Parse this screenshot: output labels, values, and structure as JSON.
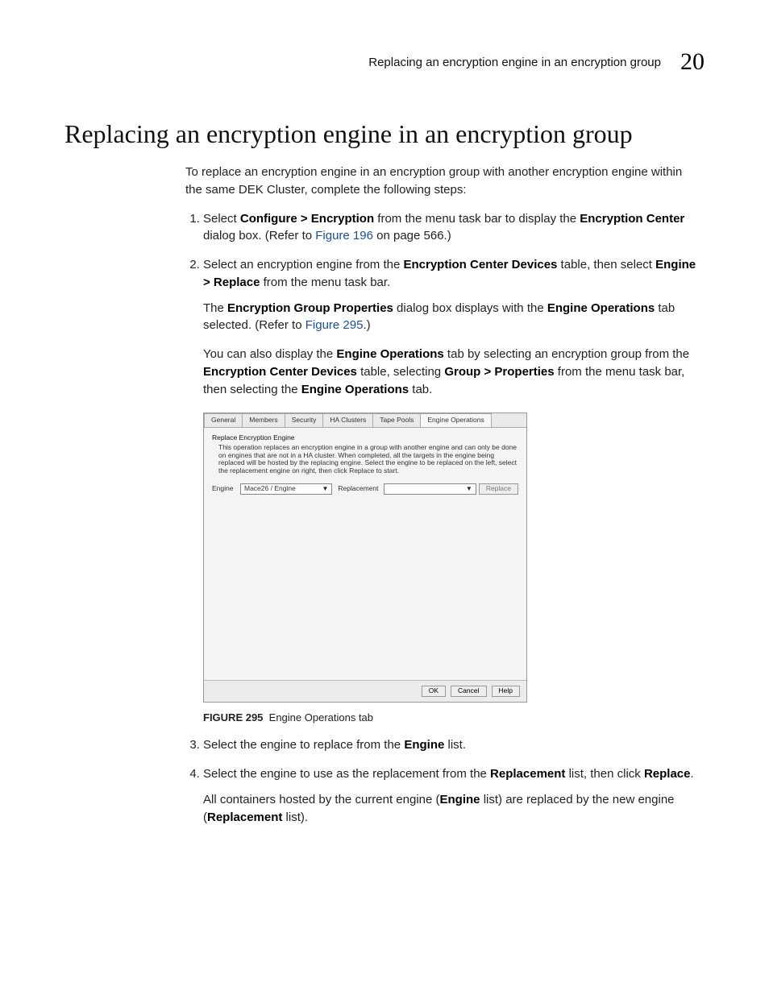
{
  "runningHeader": {
    "title": "Replacing an encryption engine in an encryption group",
    "chapterNumber": "20"
  },
  "heading": "Replacing an encryption engine in an encryption group",
  "intro": "To replace an encryption engine in an encryption group with another encryption engine within the same DEK Cluster, complete the following steps:",
  "step1": {
    "a": "Select ",
    "b": "Configure > Encryption",
    "c": " from the menu task bar to display the ",
    "d": "Encryption Center",
    "e": " dialog box. (Refer to ",
    "link": "Figure 196",
    "f": " on page 566.)"
  },
  "step2": {
    "a": "Select an encryption engine from the ",
    "b": "Encryption Center Devices",
    "c": " table, then select ",
    "d": "Engine > Replace",
    "e": " from the menu task bar.",
    "p2": {
      "a": "The ",
      "b": "Encryption Group Properties",
      "c": " dialog box displays with the ",
      "d": "Engine Operations",
      "e": " tab selected. (Refer to ",
      "link": "Figure 295",
      "f": ".)"
    },
    "p3": {
      "a": "You can also display the ",
      "b": "Engine Operations",
      "c": " tab by selecting an encryption group from the ",
      "d": "Encryption Center Devices",
      "e": " table, selecting ",
      "f": "Group > Properties",
      "g": " from the menu task bar, then selecting the ",
      "h": "Engine Operations",
      "i": " tab."
    }
  },
  "dialog": {
    "tabs": [
      "General",
      "Members",
      "Security",
      "HA Clusters",
      "Tape Pools",
      "Engine Operations"
    ],
    "activeTab": "Engine Operations",
    "sectionTitle": "Replace Encryption Engine",
    "description": "This operation replaces an encryption engine in a group with another engine and can only be done on engines that are not in a HA cluster. When completed, all the targets in the engine being replaced will be hosted by the replacing engine. Select the engine to be replaced on the left, select the replacement engine on right, then click Replace to start.",
    "engineLabel": "Engine",
    "engineValue": "Mace26 / Engine",
    "replacementLabel": "Replacement",
    "replacementValue": "",
    "replaceBtn": "Replace",
    "footer": {
      "ok": "OK",
      "cancel": "Cancel",
      "help": "Help"
    }
  },
  "figureCaption": {
    "label": "FIGURE 295",
    "text": "Engine Operations tab"
  },
  "step3": {
    "a": "Select the engine to replace from the ",
    "b": "Engine",
    "c": " list."
  },
  "step4": {
    "a": "Select the engine to use as the replacement from the ",
    "b": "Replacement",
    "c": " list, then click ",
    "d": "Replace",
    "e": ".",
    "p2": {
      "a": "All containers hosted by the current engine (",
      "b": "Engine",
      "c": " list) are replaced by the new engine (",
      "d": "Replacement",
      "e": " list)."
    }
  }
}
